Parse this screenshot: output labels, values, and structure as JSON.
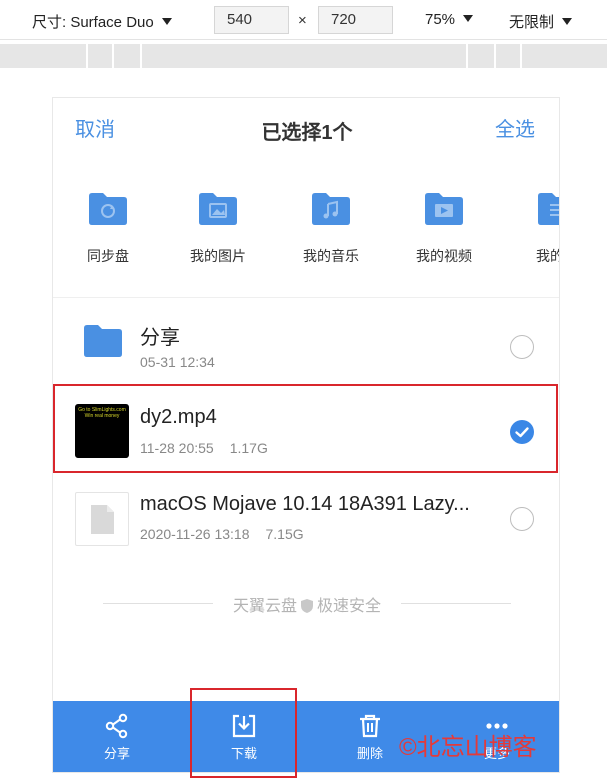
{
  "devtools": {
    "device": "尺寸: Surface Duo",
    "width": "540",
    "times": "×",
    "height": "720",
    "zoom": "75%",
    "throttle": "无限制"
  },
  "header": {
    "cancel": "取消",
    "title": "已选择1个",
    "select_all": "全选"
  },
  "quick_access": [
    {
      "label": "同步盘",
      "icon": "sync-folder-icon"
    },
    {
      "label": "我的图片",
      "icon": "image-folder-icon"
    },
    {
      "label": "我的音乐",
      "icon": "music-folder-icon"
    },
    {
      "label": "我的视频",
      "icon": "video-folder-icon"
    },
    {
      "label": "我的文",
      "icon": "document-folder-icon"
    }
  ],
  "files": [
    {
      "name": "分享",
      "date": "05-31 12:34",
      "size": "",
      "type": "folder",
      "selected": false
    },
    {
      "name": "dy2.mp4",
      "date": "11-28 20:55",
      "size": "1.17G",
      "type": "video",
      "selected": true,
      "thumb_text": "Go to SlimLights.com Win real money"
    },
    {
      "name": "macOS Mojave 10.14 18A391 Lazy...",
      "date": "2020-11-26 13:18",
      "size": "7.15G",
      "type": "file",
      "selected": false
    }
  ],
  "footer": {
    "brand": "天翼云盘",
    "tagline": "极速安全"
  },
  "actions": [
    {
      "label": "分享",
      "icon": "share-icon"
    },
    {
      "label": "下载",
      "icon": "download-icon"
    },
    {
      "label": "删除",
      "icon": "trash-icon"
    },
    {
      "label": "更多",
      "icon": "more-icon"
    }
  ],
  "watermark": "©北忘山博客",
  "colors": {
    "accent": "#4a90e2",
    "action_bar": "#3f8ae8",
    "highlight": "#d9262c",
    "watermark": "#e43a3a"
  }
}
